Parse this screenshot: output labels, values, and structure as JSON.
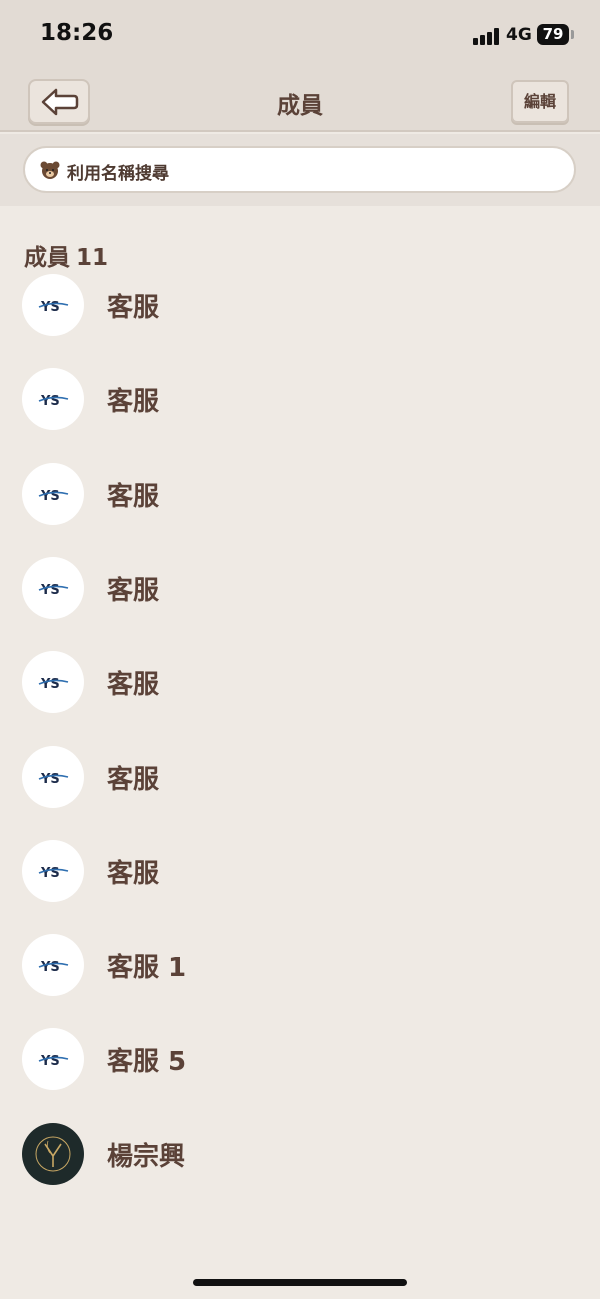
{
  "status_bar": {
    "time": "18:26",
    "network": "4G",
    "battery": "79"
  },
  "header": {
    "title": "成員",
    "edit_label": "編輯"
  },
  "search": {
    "placeholder": "利用名稱搜尋"
  },
  "members_section": {
    "label": "成員",
    "count": "11"
  },
  "members": [
    {
      "name": "客服",
      "avatar": "ys-logo"
    },
    {
      "name": "客服",
      "avatar": "ys-logo"
    },
    {
      "name": "客服",
      "avatar": "ys-logo"
    },
    {
      "name": "客服",
      "avatar": "ys-logo"
    },
    {
      "name": "客服",
      "avatar": "ys-logo"
    },
    {
      "name": "客服",
      "avatar": "ys-logo"
    },
    {
      "name": "客服",
      "avatar": "ys-logo"
    },
    {
      "name": "客服 1",
      "avatar": "ys-logo"
    },
    {
      "name": "客服 5",
      "avatar": "ys-logo"
    },
    {
      "name": "楊宗興",
      "avatar": "dark-monogram"
    }
  ],
  "colors": {
    "background": "#efeae4",
    "header_background": "#e2dbd4",
    "text_brown": "#5b4238",
    "accent_blue": "#2f6fb0"
  }
}
